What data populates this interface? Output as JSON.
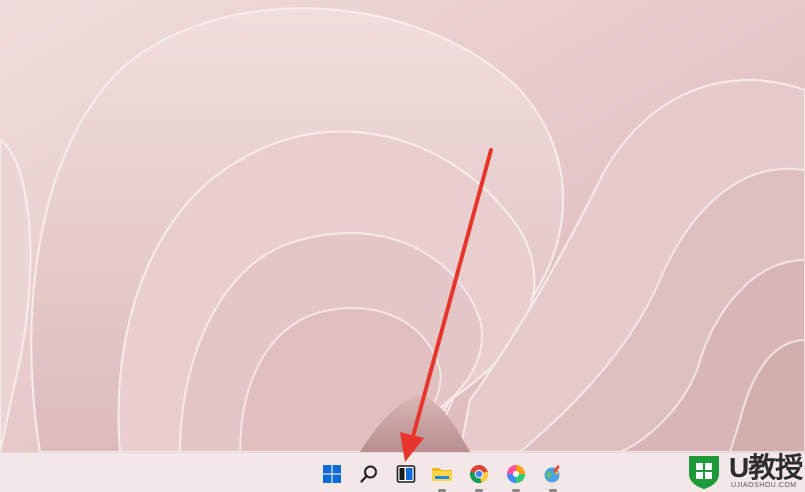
{
  "colors": {
    "wallpaper_base": "#e7cdcc",
    "taskbar_bg": "#f3e7e8",
    "arrow": "#e8352c",
    "windows_blue": "#0a6cd6"
  },
  "taskbar": {
    "items": [
      {
        "name": "start",
        "icon": "windows-logo-icon"
      },
      {
        "name": "search",
        "icon": "search-icon"
      },
      {
        "name": "task-view",
        "icon": "task-view-icon"
      },
      {
        "name": "file-explorer",
        "icon": "folder-icon",
        "running": true
      },
      {
        "name": "chrome",
        "icon": "chrome-icon",
        "running": true
      },
      {
        "name": "photos-app",
        "icon": "color-wheel-icon",
        "running": true
      },
      {
        "name": "paint-app",
        "icon": "globe-paint-icon",
        "running": true
      }
    ]
  },
  "annotation": {
    "arrow_target": "task-view-icon"
  },
  "watermark": {
    "text": "U教授",
    "subtext": "UJIAOSHOU.COM",
    "logo_icon": "windows-shield-logo-icon"
  }
}
